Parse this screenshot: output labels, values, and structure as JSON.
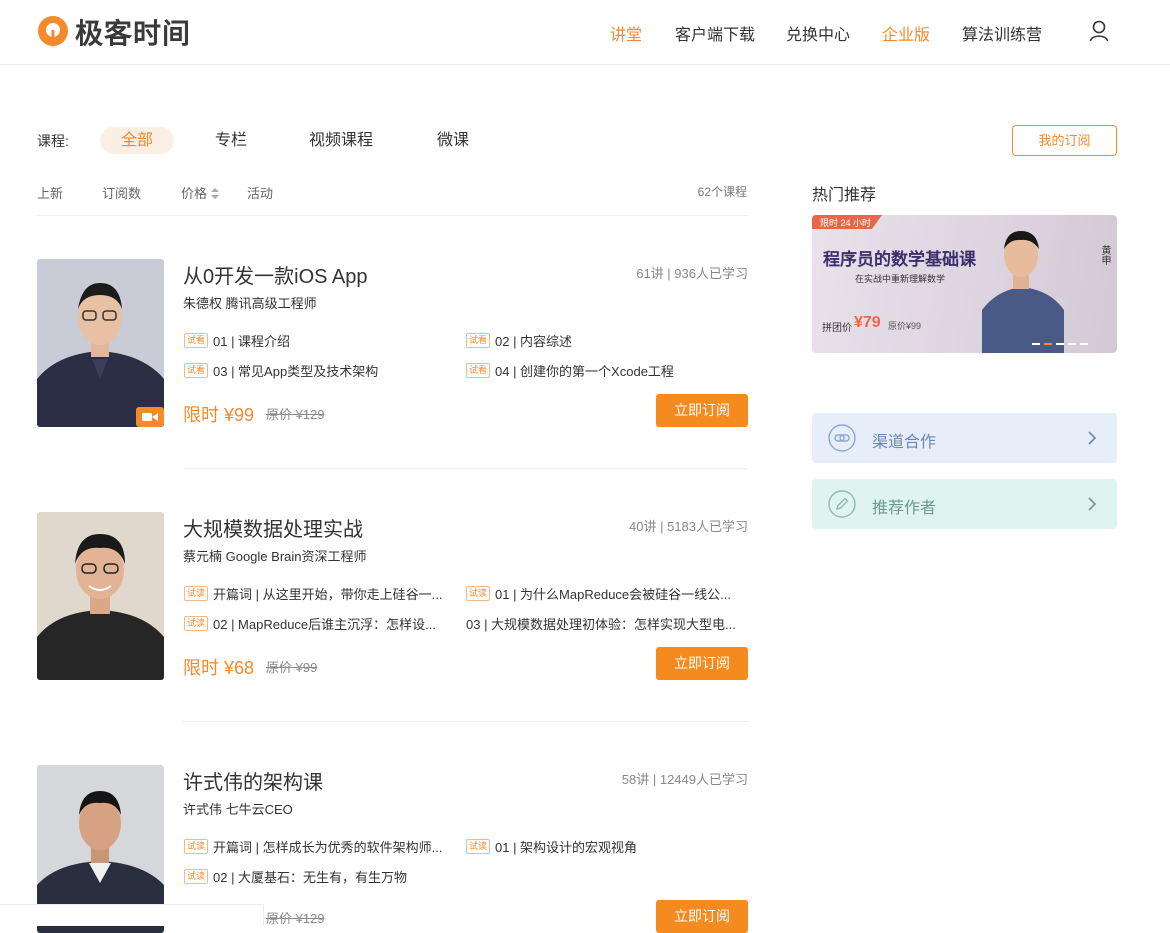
{
  "header": {
    "logo_text": "极客时间",
    "nav": [
      "讲堂",
      "客户端下载",
      "兑换中心",
      "企业版",
      "算法训练营"
    ],
    "user_icon": "user-icon"
  },
  "filter": {
    "label": "课程:",
    "tabs": [
      "全部",
      "专栏",
      "视频课程",
      "微课"
    ],
    "my_subscription": "我的订阅",
    "sorts": [
      "上新",
      "订阅数",
      "价格",
      "活动"
    ],
    "count": "62个课程"
  },
  "courses": [
    {
      "title": "从0开发一款iOS App",
      "meta": "61讲 | 936人已学习",
      "author": "朱德权 腾讯高级工程师",
      "lessons": [
        "01 | 课程介绍",
        "02 | 内容综述",
        "03 | 常见App类型及技术架构",
        "04 | 创建你的第一个Xcode工程"
      ],
      "price": "限时 ¥99",
      "original": "原价 ¥129",
      "buy": "立即订阅"
    },
    {
      "title": "大规模数据处理实战",
      "meta": "40讲 | 5183人已学习",
      "author": "蔡元楠 Google Brain资深工程师",
      "lessons": [
        "开篇词 | 从这里开始，带你走上硅谷一...",
        "01 | 为什么MapReduce会被硅谷一线公...",
        "02 | MapReduce后谁主沉浮：怎样设...",
        "03 | 大规模数据处理初体验：怎样实现大型电..."
      ],
      "price": "限时 ¥68",
      "original": "原价 ¥99",
      "buy": "立即订阅"
    },
    {
      "title": "许式伟的架构课",
      "meta": "58讲 | 12449人已学习",
      "author": "许式伟 七牛云CEO",
      "lessons": [
        "开篇词 | 怎样成长为优秀的软件架构师...",
        "01 | 架构设计的宏观视角",
        "02 | 大厦基石：无生有，有生万物"
      ],
      "original": "原价 ¥129",
      "buy": "立即订阅"
    }
  ],
  "trial_badge": "试看",
  "trial_badge_alt": "试读",
  "sidebar": {
    "hot_title": "热门推荐",
    "banner": {
      "tag": "限时 24 小时",
      "title": "程序员的数学基础课",
      "subtitle": "在实战中重新理解数学",
      "group_price_label": "拼团价",
      "group_price": "¥79",
      "orig_price": "原价¥99",
      "author_name": "黄申"
    },
    "cards": [
      {
        "label": "渠道合作",
        "icon": "link-icon",
        "bg": "#e6eef9",
        "color": "#6a86b8"
      },
      {
        "label": "推荐作者",
        "icon": "pencil-icon",
        "bg": "#dff4ef",
        "color": "#6b9a8f"
      }
    ]
  },
  "colors": {
    "accent": "#f58a2c"
  }
}
